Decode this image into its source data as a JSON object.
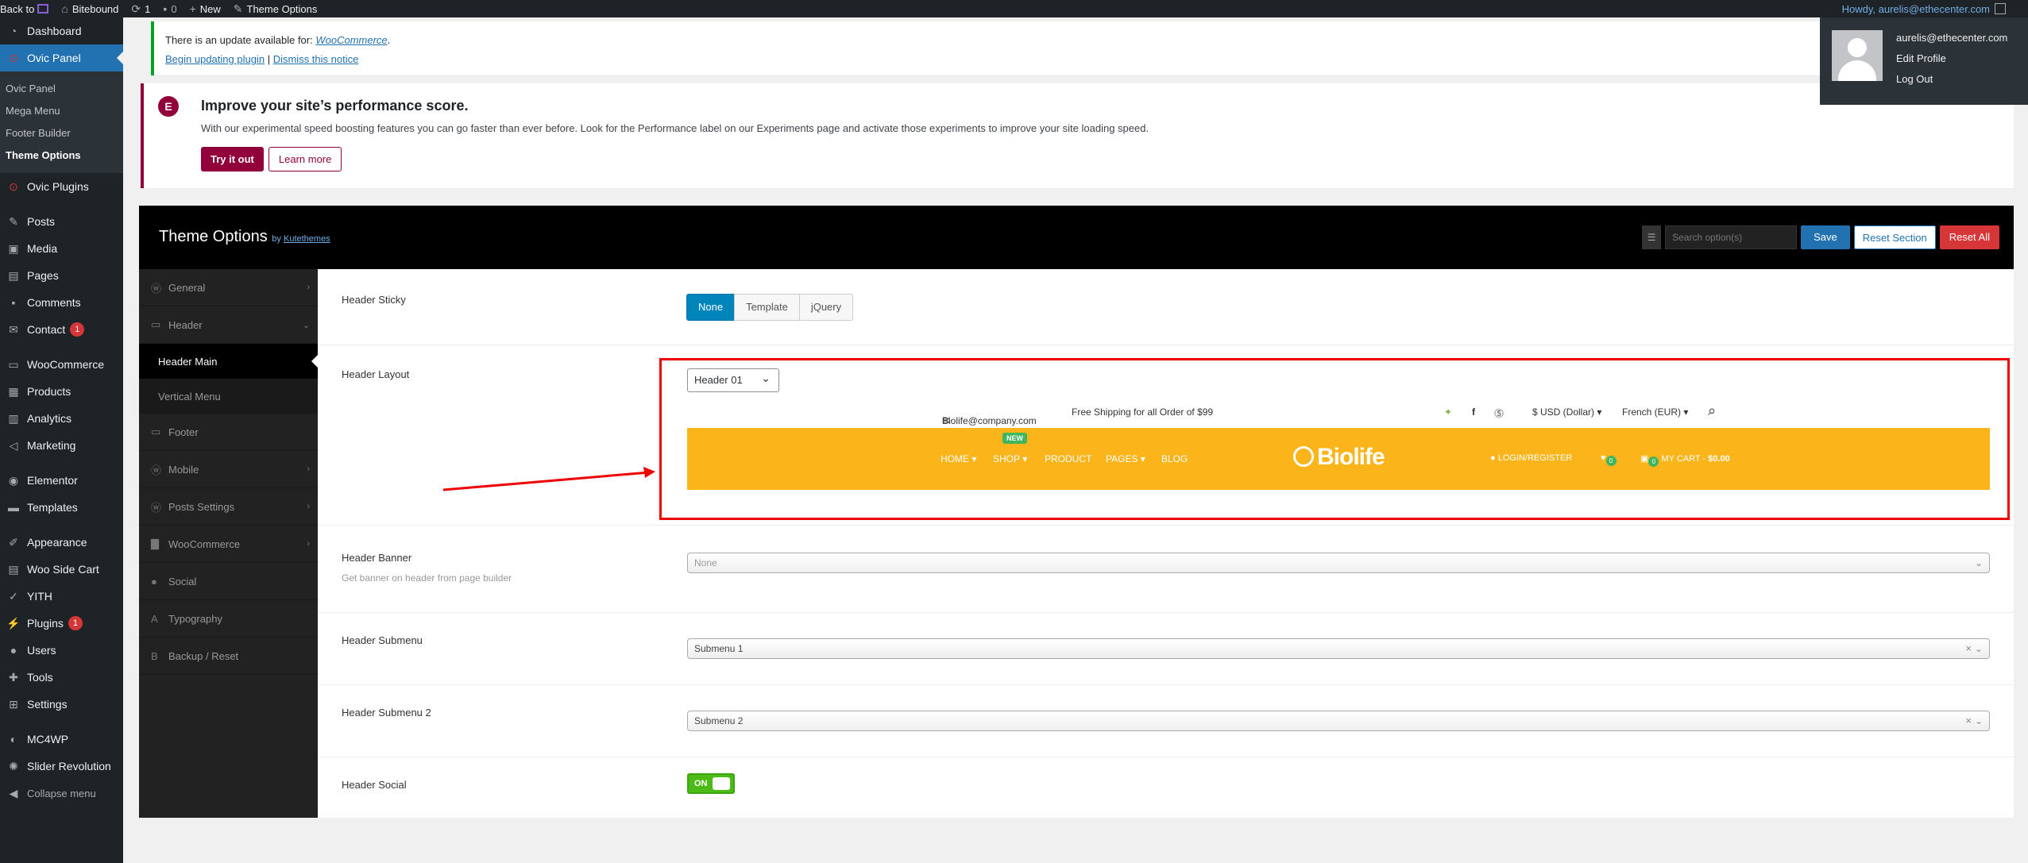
{
  "adminbar": {
    "back": "Back to",
    "site": "Bitebound",
    "updates": "1",
    "comments": "0",
    "new": "New",
    "theme_options": "Theme Options",
    "howdy": "Howdy, aurelis@ethecenter.com"
  },
  "account": {
    "email": "aurelis@ethecenter.com",
    "edit_profile": "Edit Profile",
    "logout": "Log Out"
  },
  "sidebar": {
    "dashboard": "Dashboard",
    "ovic_panel": "Ovic Panel",
    "submenu": [
      "Ovic Panel",
      "Mega Menu",
      "Footer Builder",
      "Theme Options"
    ],
    "ovic_plugins": "Ovic Plugins",
    "posts": "Posts",
    "media": "Media",
    "pages": "Pages",
    "comments": "Comments",
    "contact": "Contact",
    "contact_badge": "1",
    "woocommerce": "WooCommerce",
    "products": "Products",
    "analytics": "Analytics",
    "marketing": "Marketing",
    "elementor": "Elementor",
    "templates": "Templates",
    "appearance": "Appearance",
    "woo_side_cart": "Woo Side Cart",
    "yith": "YITH",
    "plugins": "Plugins",
    "plugins_badge": "1",
    "users": "Users",
    "tools": "Tools",
    "settings": "Settings",
    "mc4wp": "MC4WP",
    "slider_revolution": "Slider Revolution",
    "collapse": "Collapse menu"
  },
  "notice_update": {
    "text": "There is an update available for: ",
    "plugin": "WooCommerce",
    "period": ".",
    "begin": "Begin updating plugin",
    "sep": "|",
    "dismiss": "Dismiss this notice"
  },
  "notice_perf": {
    "logo": "E",
    "title": "Improve your site’s performance score.",
    "text": "With our experimental speed boosting features you can go faster than ever before. Look for the Performance label on our Experiments page and activate those experiments to improve your site loading speed.",
    "try": "Try it out",
    "learn": "Learn more"
  },
  "theme_options": {
    "title": "Theme Options",
    "by": "by ",
    "author": "Kutethemes",
    "search_placeholder": "Search option(s)",
    "save": "Save",
    "reset_section": "Reset Section",
    "reset_all": "Reset All"
  },
  "to_nav": {
    "general": "General",
    "header": "Header",
    "header_main": "Header Main",
    "vertical_menu": "Vertical Menu",
    "footer": "Footer",
    "mobile": "Mobile",
    "posts_settings": "Posts Settings",
    "woocommerce": "WooCommerce",
    "social": "Social",
    "typography": "Typography",
    "backup": "Backup / Reset"
  },
  "fields": {
    "sticky_label": "Header Sticky",
    "sticky_options": [
      "None",
      "Template",
      "jQuery"
    ],
    "layout_label": "Header Layout",
    "layout_value": "Header 01",
    "banner_label": "Header Banner",
    "banner_desc": "Get banner on header from page builder",
    "banner_value": "None",
    "submenu_label": "Header Submenu",
    "submenu_value": "Submenu 1",
    "submenu2_label": "Header Submenu 2",
    "submenu2_value": "Submenu 2",
    "social_label": "Header Social",
    "social_value": "ON"
  },
  "preview": {
    "email": "Biolife@company.com",
    "shipping": "Free Shipping for all Order of $99",
    "currency": "$ USD (Dollar) ▾",
    "language": "French (EUR) ▾",
    "home": "HOME ▾",
    "shop": "SHOP ▾",
    "new": "NEW",
    "product": "PRODUCT",
    "pages": "PAGES ▾",
    "blog": "BLOG",
    "logo": "Biolife",
    "login": "LOGIN/REGISTER",
    "wish_count": "0",
    "cart_count": "0",
    "cart": "MY CART - ",
    "cart_total": "$0.00"
  },
  "colors": {
    "accent": "#2271b1",
    "elementor": "#92003b",
    "preview_bar": "#fbb41a",
    "highlight": "#e00000"
  }
}
